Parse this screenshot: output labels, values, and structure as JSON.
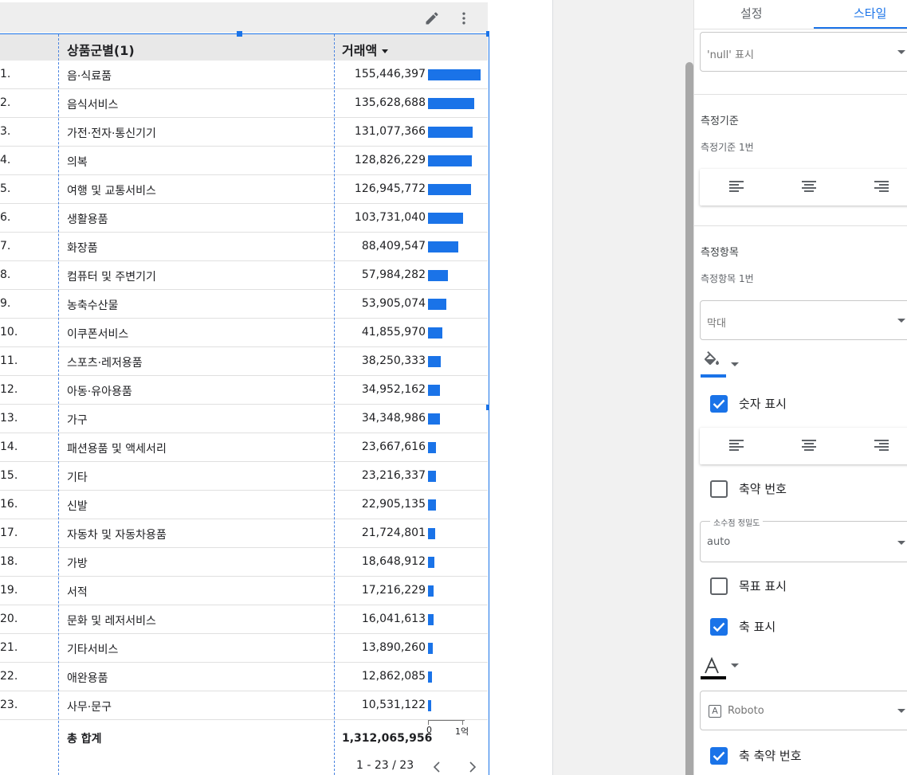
{
  "toolbar": {
    "edit_icon": "pencil-icon",
    "more_icon": "more-vert-icon"
  },
  "table": {
    "columns": {
      "category": "상품군별(1)",
      "amount": "거래액"
    },
    "rows": [
      {
        "num": "1.",
        "category": "음·식료품",
        "amount": "155,446,397",
        "value": 155446397
      },
      {
        "num": "2.",
        "category": "음식서비스",
        "amount": "135,628,688",
        "value": 135628688
      },
      {
        "num": "3.",
        "category": "가전·전자·통신기기",
        "amount": "131,077,366",
        "value": 131077366
      },
      {
        "num": "4.",
        "category": "의복",
        "amount": "128,826,229",
        "value": 128826229
      },
      {
        "num": "5.",
        "category": "여행 및 교통서비스",
        "amount": "126,945,772",
        "value": 126945772
      },
      {
        "num": "6.",
        "category": "생활용품",
        "amount": "103,731,040",
        "value": 103731040
      },
      {
        "num": "7.",
        "category": "화장품",
        "amount": "88,409,547",
        "value": 88409547
      },
      {
        "num": "8.",
        "category": "컴퓨터 및 주변기기",
        "amount": "57,984,282",
        "value": 57984282
      },
      {
        "num": "9.",
        "category": "농축수산물",
        "amount": "53,905,074",
        "value": 53905074
      },
      {
        "num": "10.",
        "category": "이쿠폰서비스",
        "amount": "41,855,970",
        "value": 41855970
      },
      {
        "num": "11.",
        "category": "스포츠·레저용품",
        "amount": "38,250,333",
        "value": 38250333
      },
      {
        "num": "12.",
        "category": "아동·유아용품",
        "amount": "34,952,162",
        "value": 34952162
      },
      {
        "num": "13.",
        "category": "가구",
        "amount": "34,348,986",
        "value": 34348986
      },
      {
        "num": "14.",
        "category": "패션용품 및 액세서리",
        "amount": "23,667,616",
        "value": 23667616
      },
      {
        "num": "15.",
        "category": "기타",
        "amount": "23,216,337",
        "value": 23216337
      },
      {
        "num": "16.",
        "category": "신발",
        "amount": "22,905,135",
        "value": 22905135
      },
      {
        "num": "17.",
        "category": "자동차 및 자동차용품",
        "amount": "21,724,801",
        "value": 21724801
      },
      {
        "num": "18.",
        "category": "가방",
        "amount": "18,648,912",
        "value": 18648912
      },
      {
        "num": "19.",
        "category": "서적",
        "amount": "17,216,229",
        "value": 17216229
      },
      {
        "num": "20.",
        "category": "문화 및 레저서비스",
        "amount": "16,041,613",
        "value": 16041613
      },
      {
        "num": "21.",
        "category": "기타서비스",
        "amount": "13,890,260",
        "value": 13890260
      },
      {
        "num": "22.",
        "category": "애완용품",
        "amount": "12,862,085",
        "value": 12862085
      },
      {
        "num": "23.",
        "category": "사무·문구",
        "amount": "10,531,122",
        "value": 10531122
      }
    ],
    "bar_max": 155446397,
    "bar_color": "#1a73e8",
    "total_label": "총 합계",
    "total_value": "1,312,065,956",
    "axis_labels": [
      "0",
      "1억"
    ],
    "pagination": "1 - 23 / 23"
  },
  "panel": {
    "tabs": [
      "설정",
      "스타일"
    ],
    "null_display": "'null' 표시",
    "dimension_section": "측정기준",
    "dimension_sub": "측정기준 1번",
    "metric_section": "측정항목",
    "metric_sub": "측정항목 1번",
    "metric_type": "막대",
    "show_number": "숫자 표시",
    "compact_number": "축약 번호",
    "decimal_legend": "소수점 정밀도",
    "decimal_value": "auto",
    "show_target": "목표 표시",
    "show_axis": "축 표시",
    "font_family": "Roboto",
    "axis_compact": "축 축약 번호",
    "accent_color": "#1a73e8",
    "font_color": "#000000"
  }
}
